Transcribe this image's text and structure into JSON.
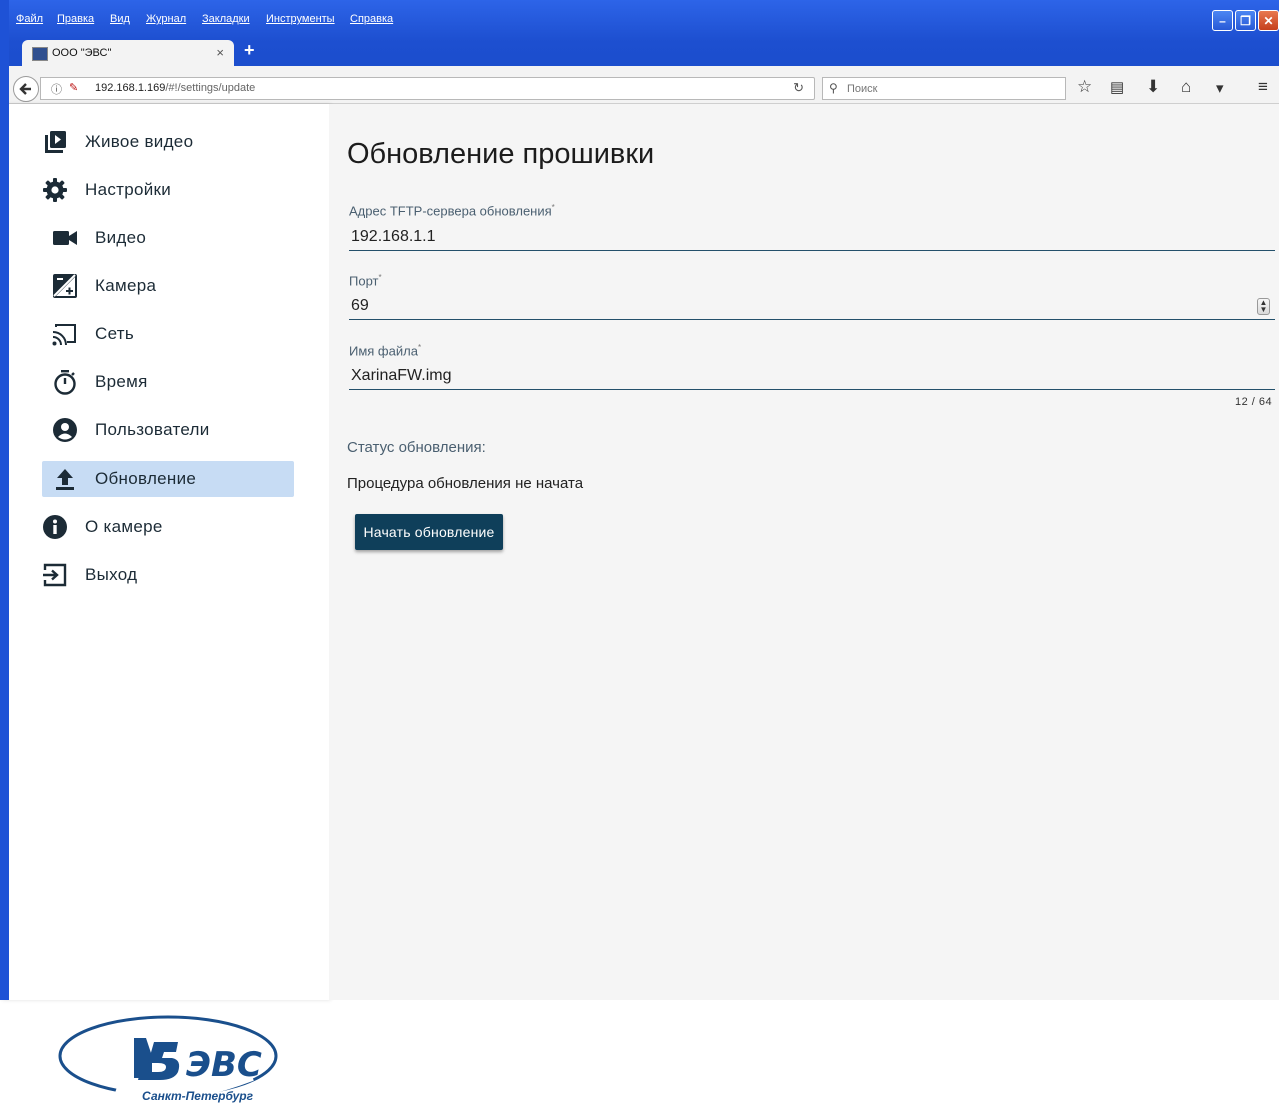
{
  "browser": {
    "menu": [
      "Файл",
      "Правка",
      "Вид",
      "Журнал",
      "Закладки",
      "Инструменты",
      "Справка"
    ],
    "tab_title": "ООО \"ЭВС\"",
    "tab_close": "×",
    "new_tab": "+",
    "url_host": "192.168.1.169",
    "url_path": "/#!/settings/update",
    "search_placeholder": "Поиск",
    "window_buttons": [
      "minimize",
      "maximize",
      "close"
    ],
    "toolbar_icons": [
      "star-icon",
      "reading-list-icon",
      "download-icon",
      "home-icon",
      "pocket-icon",
      "menu-icon"
    ]
  },
  "sidebar": {
    "items": [
      {
        "label": "Живое видео",
        "icon": "live-video-icon"
      },
      {
        "label": "Настройки",
        "icon": "gear-icon"
      },
      {
        "label": "Видео",
        "icon": "videocam-icon"
      },
      {
        "label": "Камера",
        "icon": "exposure-icon"
      },
      {
        "label": "Сеть",
        "icon": "cast-icon"
      },
      {
        "label": "Время",
        "icon": "timer-icon"
      },
      {
        "label": "Пользователи",
        "icon": "account-icon"
      },
      {
        "label": "Обновление",
        "icon": "upload-icon",
        "active": true
      },
      {
        "label": "О камере",
        "icon": "info-icon"
      },
      {
        "label": "Выход",
        "icon": "exit-icon"
      }
    ],
    "logo_text": "ЭВС",
    "logo_caption": "Санкт-Петербург"
  },
  "main": {
    "title": "Обновление прошивки",
    "fields": {
      "server": {
        "label": "Адрес TFTP-сервера обновления",
        "value": "192.168.1.1"
      },
      "port": {
        "label": "Порт",
        "value": "69"
      },
      "filename": {
        "label": "Имя файла",
        "value": "XarinaFW.img",
        "counter": "12 / 64"
      }
    },
    "required_mark": "*",
    "status_label": "Статус обновления:",
    "status_text": "Процедура обновления не начата",
    "start_button": "Начать обновление"
  },
  "colors": {
    "title_bar": "#1d4fd0",
    "active_nav": "#c7dcf4",
    "primary_button": "#0f3f5a",
    "input_underline": "#24506b"
  }
}
